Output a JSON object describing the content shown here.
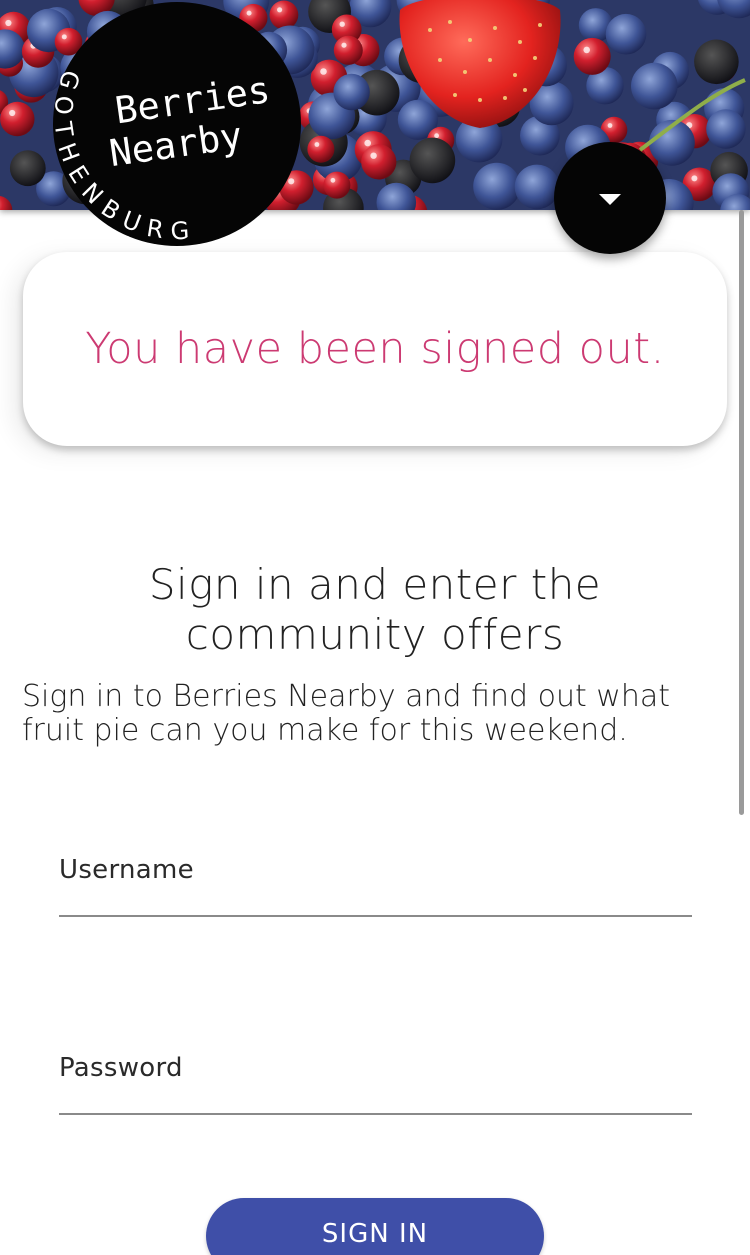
{
  "header": {
    "logo": {
      "line1": "Berries",
      "line2": "Nearby",
      "ring_text": "GOTHENBURG"
    },
    "menu_button_icon": "caret-down-icon"
  },
  "notice": {
    "message": "You have been signed out."
  },
  "intro": {
    "heading_line1": "Sign in and enter the",
    "heading_line2": "community offers",
    "body_line1": "Sign in to Berries Nearby and find out what",
    "body_line2": "fruit pie can you make for this weekend."
  },
  "form": {
    "username_label": "Username",
    "username_value": "",
    "password_label": "Password",
    "password_value": "",
    "submit_label": "SIGN IN"
  },
  "colors": {
    "notice_text": "#cc3a72",
    "primary_button": "#3f4fa8",
    "badge": "#050505"
  }
}
